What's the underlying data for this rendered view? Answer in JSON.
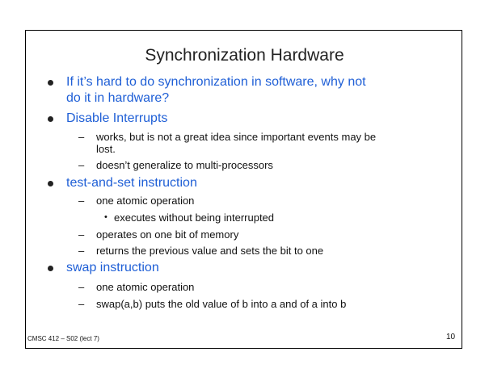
{
  "slide": {
    "title": "Synchronization Hardware",
    "bullets": [
      {
        "lines": [
          "If it’s hard to do synchronization in software, why not",
          "do it in hardware?"
        ],
        "subitems": []
      },
      {
        "lines": [
          "Disable Interrupts"
        ],
        "subitems": [
          {
            "lines": [
              "works, but is not a great idea since important events may be",
              "lost."
            ]
          },
          {
            "lines": [
              "doesn’t generalize to multi-processors"
            ]
          }
        ]
      },
      {
        "lines": [
          "test-and-set instruction"
        ],
        "subitems": [
          {
            "lines": [
              "one atomic operation"
            ],
            "subsub": [
              "executes without being interrupted"
            ]
          },
          {
            "lines": [
              "operates on one bit of memory"
            ]
          },
          {
            "lines": [
              "returns the previous value and sets the bit to one"
            ]
          }
        ]
      },
      {
        "lines": [
          "swap instruction"
        ],
        "subitems": [
          {
            "lines": [
              "one atomic operation"
            ]
          },
          {
            "lines": [
              "swap(a,b) puts the old value of b into a and of a into b"
            ]
          }
        ]
      }
    ],
    "footer_left": "CMSC 412 – S02  (lect 7)",
    "page_number": "10",
    "dash_glyph": "–",
    "subsub_glyph": "•"
  }
}
